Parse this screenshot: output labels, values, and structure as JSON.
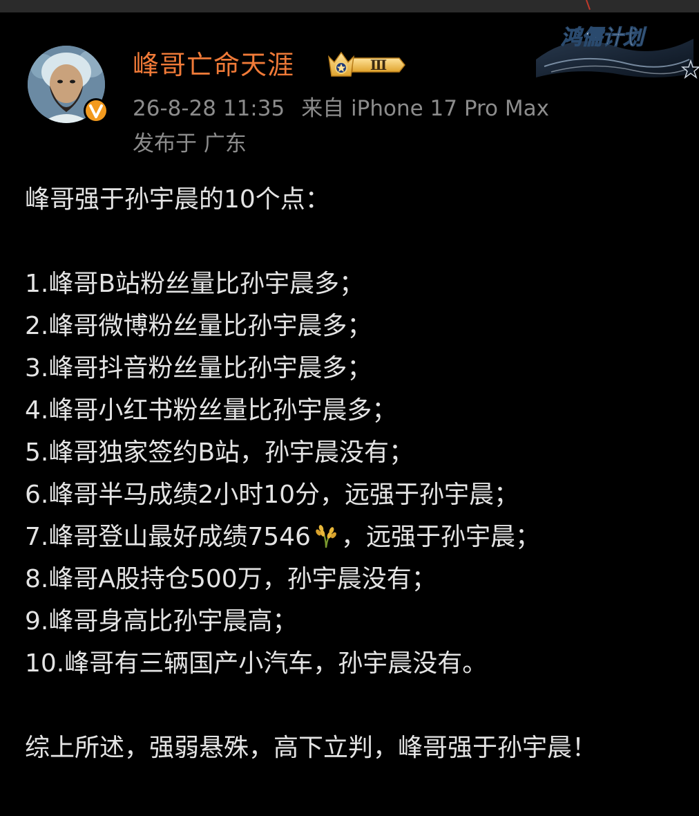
{
  "post": {
    "author": {
      "name": "峰哥亡命天涯",
      "vip_level": "Ⅲ",
      "verified": true
    },
    "time": "26-8-28 11:35",
    "source": "来自 iPhone 17 Pro Max",
    "location": "发布于 广东",
    "campaign_badge": "鸿儒计划",
    "title_line": "峰哥强于孙宇晨的10个点：",
    "points": [
      "1.峰哥B站粉丝量比孙宇晨多；",
      "2.峰哥微博粉丝量比孙宇晨多；",
      "3.峰哥抖音粉丝量比孙宇晨多；",
      "4.峰哥小红书粉丝量比孙宇晨多；",
      "5.峰哥独家签约B站，孙宇晨没有；",
      "6.峰哥半马成绩2小时10分，远强于孙宇晨；",
      {
        "before": "7.峰哥登山最好成绩7546",
        "icon": "wheat-emoji-icon",
        "after": "，远强于孙宇晨；"
      },
      "8.峰哥A股持仓500万，孙宇晨没有；",
      "9.峰哥身高比孙宇晨高；",
      "10.峰哥有三辆国产小汽车，孙宇晨没有。"
    ],
    "conclusion": "综上所述，强弱悬殊，高下立判，峰哥强于孙宇晨！"
  },
  "colors": {
    "background": "#000000",
    "username": "#f07a38",
    "meta": "#8c8c8c",
    "body_text": "#e4e4e4",
    "verified_badge": "#f39a1e"
  }
}
